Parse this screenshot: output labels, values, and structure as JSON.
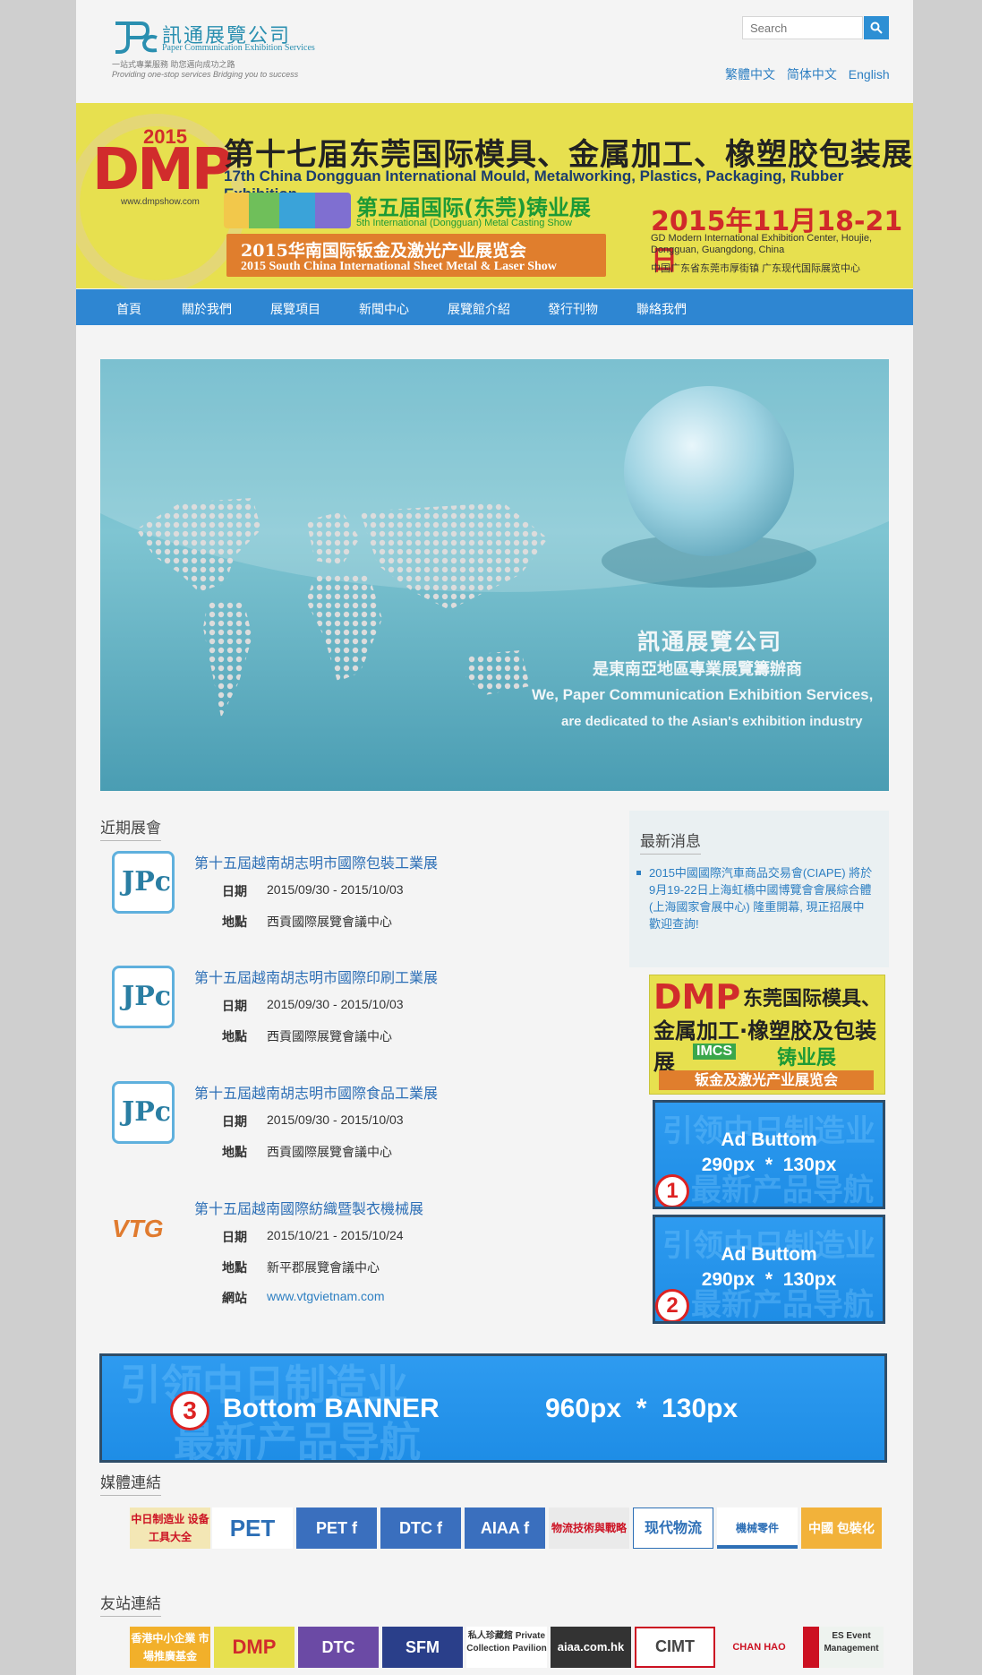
{
  "header": {
    "logo_cn": "訊通展覽公司",
    "logo_en": "Paper Communication Exhibition Services",
    "tagline_cn": "一站式專業服務 助您邁向成功之路",
    "tagline_en": "Providing one-stop services  Bridging you to success",
    "search_placeholder": "Search",
    "languages": [
      "繁體中文",
      "简体中文",
      "English"
    ]
  },
  "banner": {
    "year": "2015",
    "logo": "DMP",
    "site": "www.dmpshow.com",
    "title_cn": "第十七届东莞国际模具、金属加工、橡塑胶包装展",
    "title_en": "17th China Dongguan International Mould, Metalworking, Plastics, Packaging, Rubber Exhibition",
    "cast_cn": "第五届国际(东莞)铸业展",
    "cast_en": "5th International (Dongguan) Metal Casting Show",
    "sheet_cn": "2015华南国际钣金及激光产业展览会",
    "sheet_en": "2015 South China International Sheet Metal & Laser Show",
    "date": "2015年11月18-21日",
    "venue_en": "GD Modern International Exhibition Center, Houjie, Dongguan, Guangdong, China",
    "venue_cn": "中国广东省东莞市厚街镇 广东现代国际展览中心"
  },
  "nav": [
    "首頁",
    "關於我們",
    "展覽項目",
    "新聞中心",
    "展覽館介紹",
    "發行刊物",
    "聯絡我們"
  ],
  "hero": {
    "line1": "訊通展覽公司",
    "line2": "是東南亞地區專業展覽籌辦商",
    "line3": "We, Paper Communication Exhibition Services,",
    "line4": "are dedicated to the Asian's exhibition industry"
  },
  "events_section": {
    "title": "近期展會",
    "date_label": "日期",
    "venue_label": "地點",
    "web_label": "網站",
    "items": [
      {
        "title": "第十五屆越南胡志明市國際包裝工業展",
        "date": "2015/09/30 - 2015/10/03",
        "venue": "西貢國際展覽會議中心",
        "logo": "JPc"
      },
      {
        "title": "第十五屆越南胡志明市國際印刷工業展",
        "date": "2015/09/30 - 2015/10/03",
        "venue": "西貢國際展覽會議中心",
        "logo": "JPc"
      },
      {
        "title": "第十五屆越南胡志明市國際食品工業展",
        "date": "2015/09/30 - 2015/10/03",
        "venue": "西貢國際展覽會議中心",
        "logo": "JPc"
      },
      {
        "title": "第十五屆越南國際紡織暨製衣機械展",
        "date": "2015/10/21 - 2015/10/24",
        "venue": "新平郡展覽會議中心",
        "web": "www.vtgvietnam.com",
        "logo": "VTG"
      }
    ]
  },
  "news": {
    "title": "最新消息",
    "items": [
      "2015中國國際汽車商品交易會(CIAPE) 將於9月19-22日上海虹橋中國博覽會會展綜合體 (上海國家會展中心) 隆重開幕, 現正招展中 歡迎查詢!"
    ]
  },
  "side_dmp": {
    "logo": "DMP",
    "t1": "东莞国际模具、",
    "t2": "金属加工·橡塑胶及包装展",
    "cast": "铸业展",
    "sheet": "钣金及激光产业展览会"
  },
  "ads": [
    {
      "num": "1",
      "title": "Ad Buttom",
      "size": "290px  *  130px",
      "bg1": "引领中日制造业",
      "bg2": "最新产品导航"
    },
    {
      "num": "2",
      "title": "Ad Buttom",
      "size": "290px  *  130px",
      "bg1": "引领中日制造业",
      "bg2": "最新产品导航"
    }
  ],
  "bottom_banner": {
    "num": "3",
    "title": "Bottom BANNER",
    "size": "960px  *  130px",
    "bg1": "引领中日制造业",
    "bg2": "最新产品导航"
  },
  "media": {
    "title": "媒體連結",
    "logos": [
      "中日制造业 设备工具大全",
      "PET",
      "PET f",
      "DTC f",
      "AIAA f",
      "物流技術與戰略",
      "现代物流",
      "機械零件",
      "中國 包裝化"
    ]
  },
  "friends": {
    "title": "友站連結",
    "logos": [
      "香港中小企業 市場推廣基金",
      "DMP",
      "DTC",
      "SFM",
      "私人珍藏館 Private Collection Pavilion",
      "aiaa.com.hk",
      "CIMT",
      "CHAN HAO",
      "ES Event Management"
    ]
  },
  "colors": {
    "nav_blue": "#2e86d2",
    "link_blue": "#2d7fc2",
    "banner_yellow": "#e7e04f",
    "ad_blue": "#2196f3"
  }
}
